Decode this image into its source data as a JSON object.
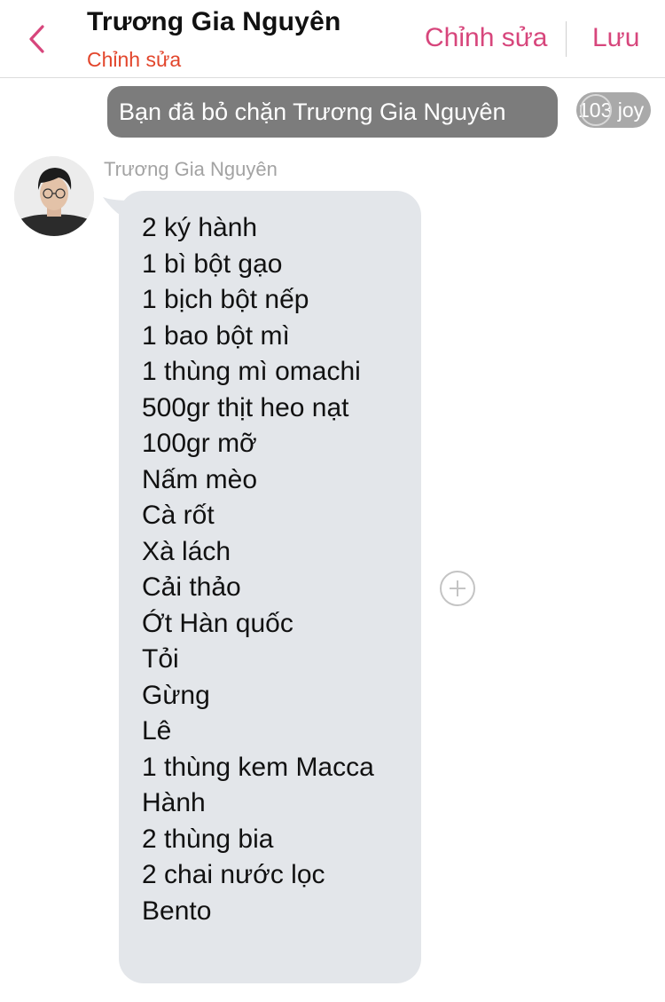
{
  "header": {
    "back_icon": "chevron-left-icon",
    "contact_name": "Trương Gia Nguyên",
    "contact_subtitle": "Chỉnh sửa",
    "edit_label": "Chỉnh sửa",
    "save_label": "Lưu",
    "accent_color": "#d7467c",
    "subtitle_color": "#e2452b"
  },
  "system_notice": {
    "text": "Bạn đã bỏ chặn Trương Gia Nguyên",
    "badge": "103 joy"
  },
  "message": {
    "sender_name": "Trương Gia Nguyên",
    "avatar_icon": "avatar-photo",
    "items": [
      "2 ký hành",
      "1 bì bột gạo",
      "1 bịch bột nếp",
      "1 bao bột mì",
      "1 thùng mì omachi",
      "500gr thịt heo nạt",
      "100gr mỡ",
      "Nấm mèo",
      "Cà rốt",
      "Xà lách",
      "Cải thảo",
      "Ớt Hàn quốc",
      "Tỏi",
      "Gừng",
      "Lê",
      "1 thùng kem Macca",
      "Hành",
      "2 thùng bia",
      "2 chai nước lọc",
      "Bento"
    ],
    "react_icon": "add-reaction-icon",
    "bubble_color": "#e3e6ea"
  }
}
